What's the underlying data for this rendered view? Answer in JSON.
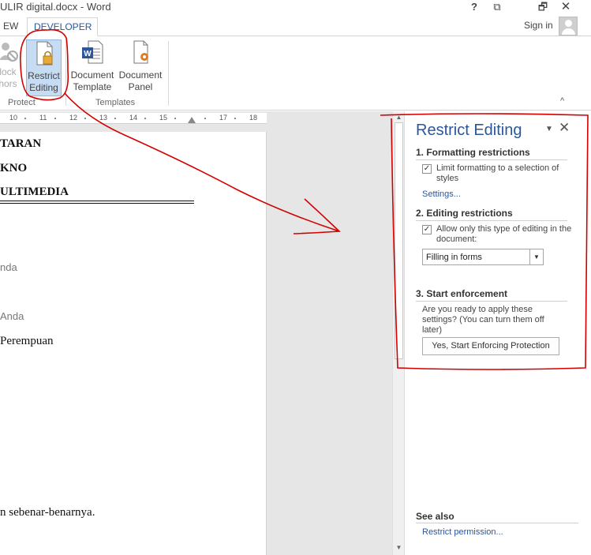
{
  "window": {
    "title": "ULIR digital.docx - Word",
    "help": "?",
    "ribbon_display_options": "⧉",
    "restore": "🗗",
    "close": "✕"
  },
  "tabs": {
    "view": "EW",
    "developer": "DEVELOPER"
  },
  "account": {
    "sign_in": "Sign in"
  },
  "ribbon": {
    "block_authors_line1": "lock",
    "block_authors_line2": "hors",
    "restrict_editing_line1": "Restrict",
    "restrict_editing_line2": "Editing",
    "document_template_line1": "Document",
    "document_template_line2": "Template",
    "document_panel_line1": "Document",
    "document_panel_line2": "Panel",
    "group_protect": "Protect",
    "group_templates": "Templates",
    "collapse": "^"
  },
  "ruler": {
    "ticks": [
      "10",
      "11",
      "12",
      "13",
      "14",
      "15",
      "17",
      "18"
    ]
  },
  "document": {
    "line1": "TARAN",
    "line2": "KNO",
    "line3": "ULTIMEDIA",
    "line4": "nda",
    "line5": "Anda",
    "line6": "Perempuan",
    "line7": "n sebenar-benarnya."
  },
  "scrollbar": {
    "up": "▲",
    "down": "▼"
  },
  "pane": {
    "title": "Restrict Editing",
    "menu": "▼",
    "close": "✕",
    "section1": {
      "heading": "1. Formatting restrictions",
      "checkbox_label": "Limit formatting to a selection of styles",
      "checked": "✓",
      "settings_link": "Settings..."
    },
    "section2": {
      "heading": "2. Editing restrictions",
      "checkbox_label": "Allow only this type of editing in the document:",
      "checked": "✓",
      "select_value": "Filling in forms",
      "select_arrow": "▼"
    },
    "section3": {
      "heading": "3. Start enforcement",
      "description": "Are you ready to apply these settings? (You can turn them off later)",
      "button": "Yes, Start Enforcing Protection"
    },
    "see_also": {
      "heading": "See also",
      "link": "Restrict permission..."
    }
  },
  "colors": {
    "accent": "#2b579a",
    "selected_button": "#c5dcf2",
    "annotation": "#d40000"
  }
}
